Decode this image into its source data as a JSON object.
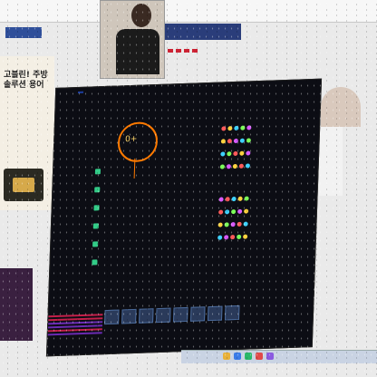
{
  "background_site": {
    "logo_text": "",
    "nav_text": "",
    "tabs": [
      "",
      "",
      "",
      ""
    ],
    "ad_title": "고블린! 주방 솔루션 용어",
    "ad_body": "",
    "colors": {
      "nav": "#2a3d7a",
      "tab": "#cc2233"
    }
  },
  "game": {
    "title_parts": [
      "",
      "",
      "",
      ""
    ],
    "subtitle": "",
    "radar_value": "0+",
    "rows": [
      {
        "name": "",
        "a": "",
        "b": ""
      },
      {
        "name": "",
        "a": "",
        "b": ""
      },
      {
        "name": "",
        "a": "",
        "b": ""
      },
      {
        "name": "",
        "a": "",
        "b": ""
      },
      {
        "name": "",
        "a": "",
        "b": ""
      },
      {
        "name": "",
        "a": "",
        "b": ""
      },
      {
        "name": "",
        "a": "",
        "b": ""
      },
      {
        "name": "",
        "a": "",
        "b": ""
      }
    ],
    "bottom_labels": [
      "",
      "",
      "",
      "",
      "",
      ""
    ]
  },
  "taskbar": {
    "icons": [
      "folder-icon",
      "browser-icon",
      "chat-icon",
      "game-icon",
      "app-icon"
    ]
  }
}
